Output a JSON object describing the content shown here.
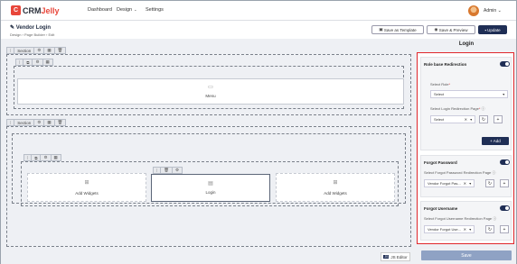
{
  "brand": {
    "mark": "C",
    "name_prefix": "CRM",
    "name_suffix": "Jelly"
  },
  "nav": {
    "dashboard": "Dashboard",
    "design": "Design",
    "settings": "Settings"
  },
  "user": {
    "name": "Admin"
  },
  "page": {
    "title": "Vendor Login",
    "breadcrumb": "Design  ›  Page Builder  ›  Edit",
    "save_template": "Save as Template",
    "save_preview": "Save & Preview",
    "update": "Update"
  },
  "canvas": {
    "section_label": "Section",
    "menu_widget": "Menu",
    "login_widget": "Login",
    "add_widgets_left": "Add Widgets",
    "add_widgets_right": "Add Widgets"
  },
  "panel": {
    "title": "Login",
    "role_redirection": {
      "heading": "Role base Redirection",
      "enabled": true,
      "select_role_label": "Select Role",
      "select_role_value": "Select",
      "redirect_page_label": "Select Login Redirection Page",
      "redirect_page_value": "Select",
      "add_label": "+ Add"
    },
    "forgot_password": {
      "heading": "Forgot Password",
      "enabled": true,
      "redirect_label": "Select Forgot Password Redirection Page",
      "redirect_value": "Vendor Forgot Pas..."
    },
    "forgot_username": {
      "heading": "Forgot Username",
      "enabled": true,
      "redirect_label": "Select Forgot Username Redirection Page",
      "redirect_value": "Vendor Forgot Use..."
    }
  },
  "footer": {
    "js_editor": "JS Editor",
    "js_badge": "JS",
    "save": "Save"
  },
  "colors": {
    "primary": "#1f2e55",
    "highlight_border": "#e0262b",
    "brand_red": "#e8463a"
  }
}
